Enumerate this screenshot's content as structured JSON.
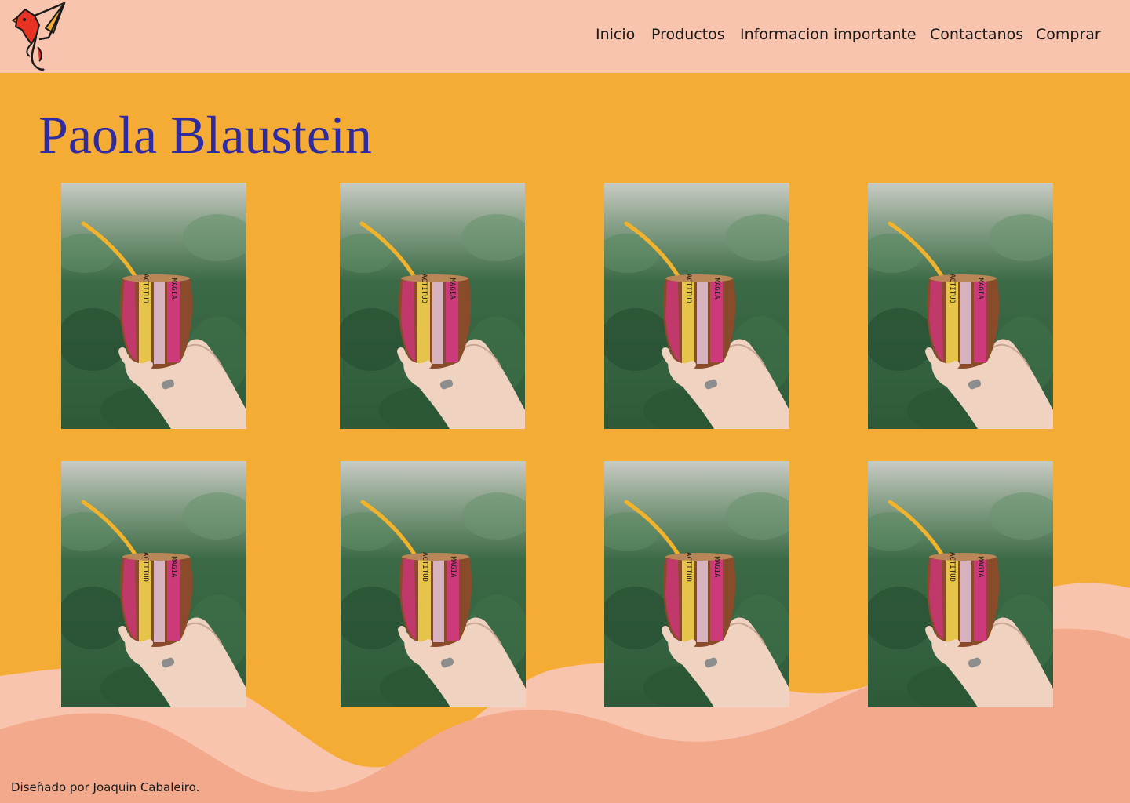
{
  "header": {
    "logo_icon": "bird-logo-icon",
    "nav": [
      {
        "label": "Inicio"
      },
      {
        "label": "Productos"
      },
      {
        "label": "Informacion importante"
      },
      {
        "label": "Contactanos"
      },
      {
        "label": "Comprar"
      }
    ]
  },
  "main": {
    "title": "Paola Blaustein",
    "gallery": {
      "image_icon": "mate-cup-photo",
      "mate_text_left": "ACTITUD",
      "mate_text_right": "MAGIA",
      "count": 8
    }
  },
  "footer": {
    "credit": "Diseñado por Joaquin Cabaleiro."
  },
  "colors": {
    "header_bg": "#f9c4ad",
    "page_bg": "#f5ac35",
    "title": "#2f2ba0",
    "wave_light": "#f9c4ad",
    "wave_dark": "#f2a98c"
  }
}
